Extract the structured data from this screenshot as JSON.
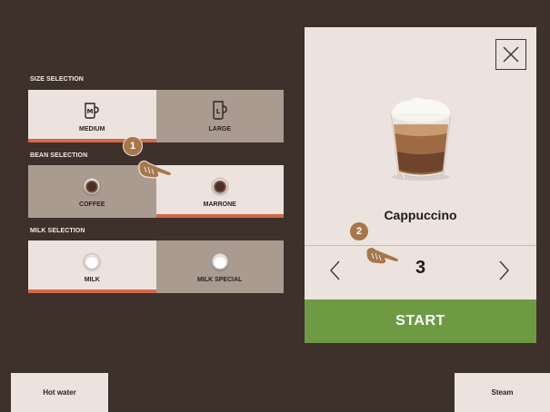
{
  "size_section": {
    "title": "SIZE SELECTION",
    "options": [
      {
        "label": "MEDIUM",
        "icon": "cup-medium-icon",
        "cup_letter": "M",
        "selected": true
      },
      {
        "label": "LARGE",
        "icon": "cup-large-icon",
        "cup_letter": "L",
        "selected": false
      }
    ]
  },
  "bean_section": {
    "title": "BEAN SELECTION",
    "options": [
      {
        "label": "COFFEE",
        "icon": "coffee-bean-icon",
        "selected": false
      },
      {
        "label": "MARRONE",
        "icon": "coffee-bean-icon",
        "selected": true
      }
    ]
  },
  "milk_section": {
    "title": "MILK SELECTION",
    "options": [
      {
        "label": "MILK",
        "icon": "milk-icon",
        "selected": true
      },
      {
        "label": "MILK SPECIAL",
        "icon": "milk-icon",
        "selected": false
      }
    ]
  },
  "annotations": [
    {
      "number": "1",
      "icon": "pointing-hand-icon"
    },
    {
      "number": "2",
      "icon": "pointing-hand-icon"
    }
  ],
  "product": {
    "name": "Cappuccino",
    "quantity": "3",
    "start_label": "START",
    "close_icon": "close-icon",
    "prev_icon": "chevron-left-icon",
    "next_icon": "chevron-right-icon"
  },
  "bottom": {
    "hot_water": "Hot water",
    "steam": "Steam"
  },
  "colors": {
    "background": "#3e302b",
    "light_tile": "#ece3df",
    "dark_tile": "#aa9b90",
    "selected_accent": "#d2694a",
    "start_green": "#6f9a44",
    "badge": "#a6774b"
  }
}
